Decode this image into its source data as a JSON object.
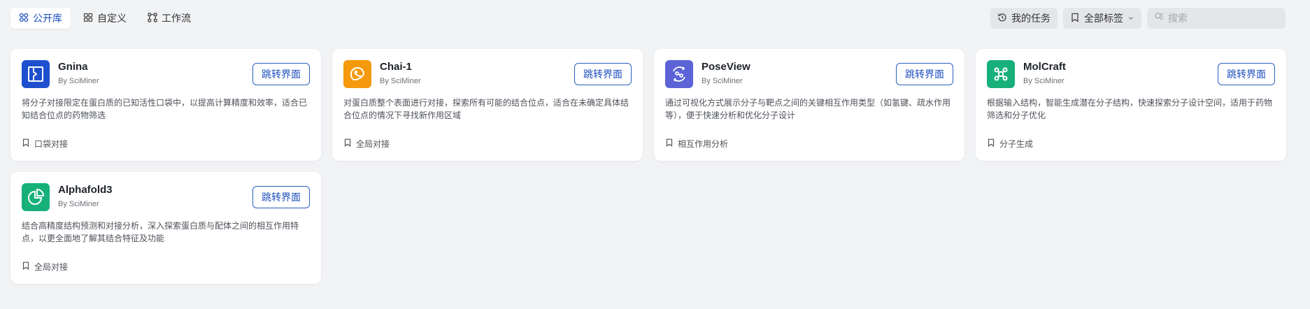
{
  "tabs": [
    {
      "label": "公开库",
      "icon": "grid-icon",
      "active": true
    },
    {
      "label": "自定义",
      "icon": "apps-icon",
      "active": false
    },
    {
      "label": "工作流",
      "icon": "workflow-icon",
      "active": false
    }
  ],
  "toolbar": {
    "tasks_label": "我的任务",
    "tags_label": "全部标签",
    "search_placeholder": "搜索"
  },
  "cards": [
    {
      "name": "Gnina",
      "author": "By SciMiner",
      "button": "跳转界面",
      "description": "将分子对接限定在蛋白质的已知活性口袋中，以提高计算精度和效率，适合已知结合位点的药物筛选",
      "tag": "口袋对接",
      "logo_color": "#1e4fcf",
      "logo_icon": "pocket-icon"
    },
    {
      "name": "Chai-1",
      "author": "By SciMiner",
      "button": "跳转界面",
      "description": "对蛋白质整个表面进行对接，探索所有可能的结合位点，适合在未确定具体结合位点的情况下寻找新作用区域",
      "tag": "全局对接",
      "logo_color": "#f59a0c",
      "logo_icon": "chai-icon"
    },
    {
      "name": "PoseView",
      "author": "By SciMiner",
      "button": "跳转界面",
      "description": "通过可视化方式展示分子与靶点之间的关键相互作用类型（如氢键、疏水作用等），便于快速分析和优化分子设计",
      "tag": "相互作用分析",
      "logo_color": "#5b63d6",
      "logo_icon": "interaction-icon"
    },
    {
      "name": "MolCraft",
      "author": "By SciMiner",
      "button": "跳转界面",
      "description": "根据输入结构，智能生成潜在分子结构，快速探索分子设计空间，适用于药物筛选和分子优化",
      "tag": "分子生成",
      "logo_color": "#17b07a",
      "logo_icon": "molecule-icon"
    },
    {
      "name": "Alphafold3",
      "author": "By SciMiner",
      "button": "跳转界面",
      "description": "结合高精度结构预测和对接分析，深入探索蛋白质与配体之间的相互作用特点，以更全面地了解其结合特征及功能",
      "tag": "全局对接",
      "logo_color": "#17b07a",
      "logo_icon": "pie-icon"
    }
  ]
}
